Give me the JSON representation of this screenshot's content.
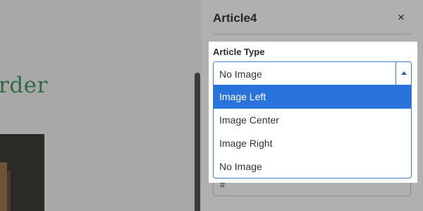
{
  "canvas": {
    "heading_fragment": "rder"
  },
  "panel": {
    "title": "Article4",
    "close_label": "×",
    "hash_value": "#"
  },
  "article_type": {
    "label": "Article Type",
    "selected_value": "No Image",
    "options": [
      {
        "label": "Image Left",
        "highlighted": true
      },
      {
        "label": "Image Center",
        "highlighted": false
      },
      {
        "label": "Image Right",
        "highlighted": false
      },
      {
        "label": "No Image",
        "highlighted": false
      }
    ]
  },
  "colors": {
    "highlight_option": "#2a73dd",
    "focus_border": "#3b82d6",
    "heading_green": "#2f6b40"
  }
}
